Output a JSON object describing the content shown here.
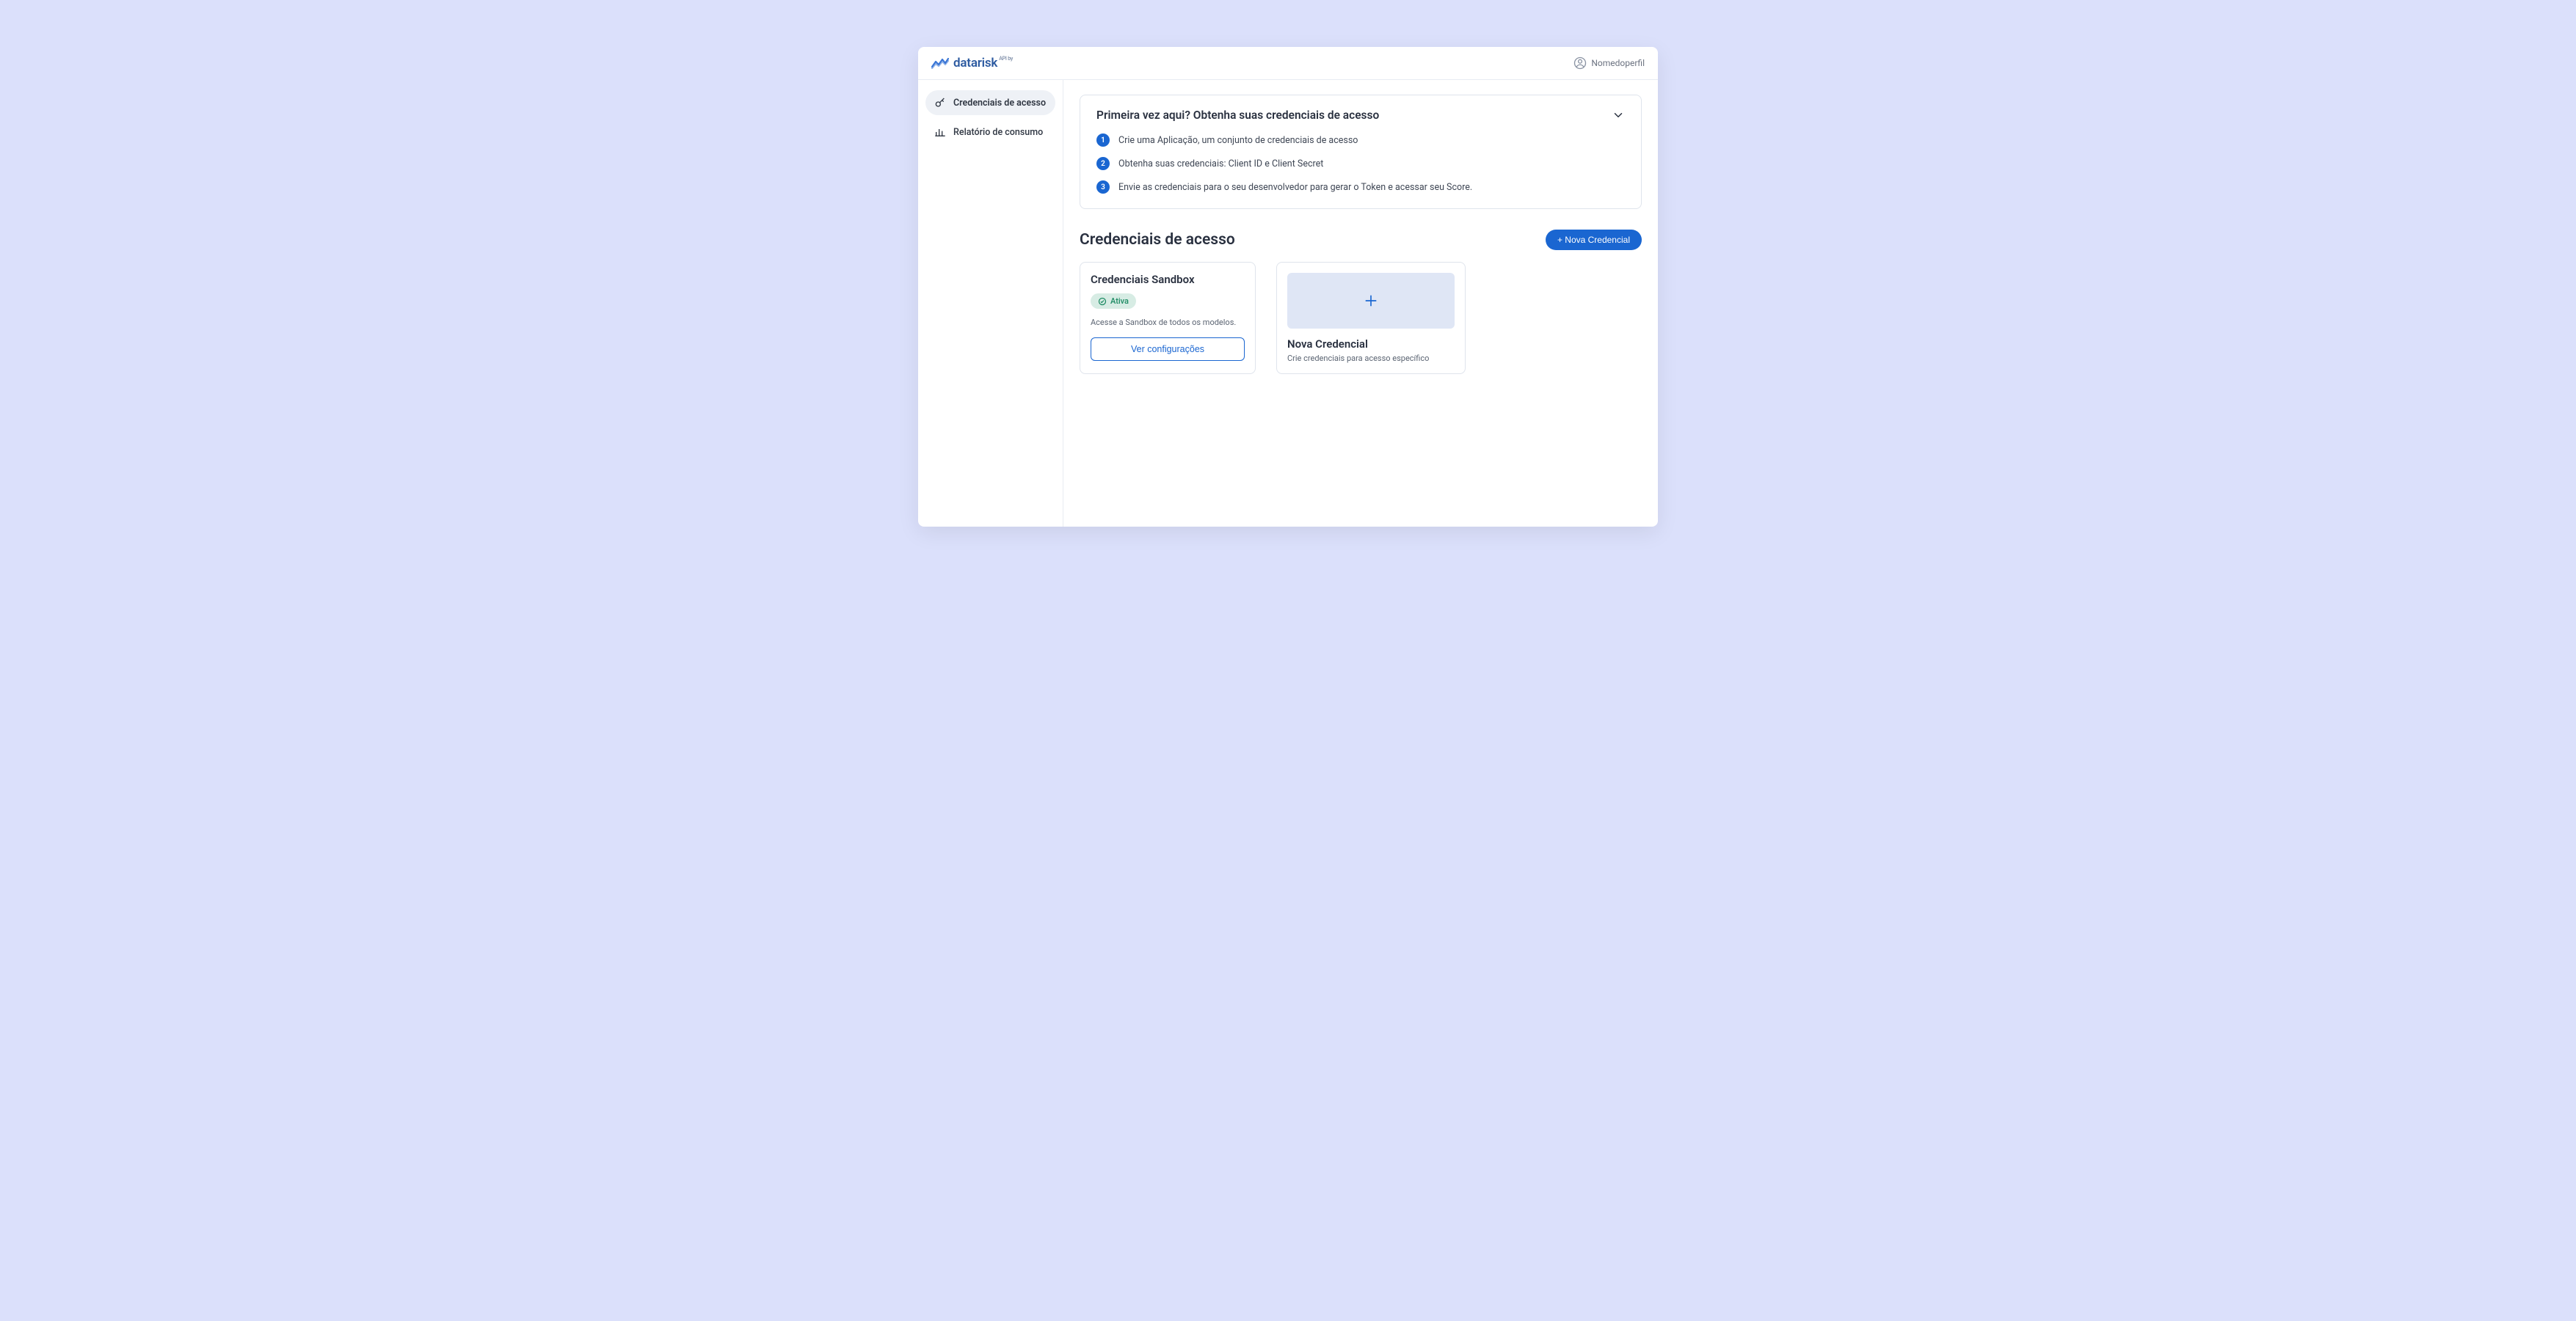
{
  "brand": {
    "name": "datarisk",
    "tag": "API by"
  },
  "profile": {
    "label": "Nomedoperfil"
  },
  "sidebar": {
    "items": [
      {
        "label": "Credenciais de acesso",
        "active": true
      },
      {
        "label": "Relatório de consumo",
        "active": false
      }
    ]
  },
  "intro": {
    "title": "Primeira vez aqui? Obtenha suas credenciais de acesso",
    "steps": [
      {
        "n": "1",
        "text": "Crie uma Aplicação, um conjunto de credenciais de acesso"
      },
      {
        "n": "2",
        "text": "Obtenha suas credenciais: Client ID e Client Secret"
      },
      {
        "n": "3",
        "text": "Envie as credenciais para o seu desenvolvedor para gerar o Token e acessar seu Score."
      }
    ]
  },
  "section": {
    "title": "Credenciais de acesso",
    "new_button": "+ Nova Credencial"
  },
  "sandbox_card": {
    "title": "Credenciais Sandbox",
    "badge": "Ativa",
    "desc": "Acesse a Sandbox de todos os modelos.",
    "button": "Ver configurações"
  },
  "new_card": {
    "title": "Nova Credencial",
    "desc": "Crie credenciais para acesso específico"
  }
}
